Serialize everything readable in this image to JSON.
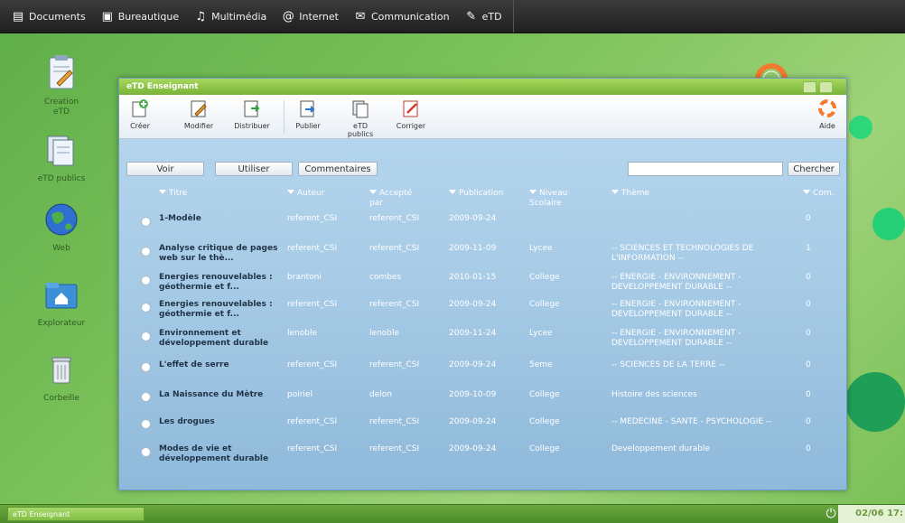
{
  "menubar": {
    "items": [
      {
        "label": "Documents",
        "icon": "documents-icon"
      },
      {
        "label": "Bureautique",
        "icon": "briefcase-icon"
      },
      {
        "label": "Multimédia",
        "icon": "music-note-icon"
      },
      {
        "label": "Internet",
        "icon": "at-sign-icon"
      },
      {
        "label": "Communication",
        "icon": "chat-bubbles-icon"
      },
      {
        "label": "eTD",
        "icon": "etd-icon"
      }
    ]
  },
  "desktop": {
    "icons": [
      {
        "label": "Creation\neTD",
        "icon": "create-etd-icon"
      },
      {
        "label": "eTD publics",
        "icon": "etd-publics-icon"
      },
      {
        "label": "Web",
        "icon": "globe-icon"
      },
      {
        "label": "Explorateur",
        "icon": "home-folder-icon"
      },
      {
        "label": "Corbeille",
        "icon": "trash-icon"
      }
    ]
  },
  "window": {
    "title": "eTD Enseignant",
    "toolbar": [
      {
        "label": "Créer",
        "icon": "create-icon"
      },
      {
        "label": "Modifier",
        "icon": "edit-icon"
      },
      {
        "label": "Distribuer",
        "icon": "distribute-icon"
      },
      {
        "label": "Publier",
        "icon": "publish-icon"
      },
      {
        "label": "eTD publics",
        "icon": "public-docs-icon"
      },
      {
        "label": "Corriger",
        "icon": "correct-icon"
      }
    ],
    "help_label": "Aide",
    "buttons": {
      "voir": "Voir",
      "utiliser": "Utiliser",
      "commentaires": "Commentaires",
      "chercher": "Chercher"
    },
    "search": {
      "value": ""
    },
    "columns": [
      "Titre",
      "Auteur",
      "Accepté par",
      "Publication",
      "Niveau Scolaire",
      "Thème",
      "Com."
    ],
    "rows": [
      {
        "titre": "1-Modèle",
        "auteur": "referent_CSI",
        "accepte": "referent_CSI",
        "publication": "2009-09-24",
        "niveau": "",
        "theme": "",
        "com": "0"
      },
      {
        "titre": "Analyse critique de pages web sur le thè...",
        "auteur": "referent_CSI",
        "accepte": "referent_CSI",
        "publication": "2009-11-09",
        "niveau": "Lycee",
        "theme": "-- SCIENCES ET TECHNOLOGIES DE L'INFORMATION --",
        "com": "1"
      },
      {
        "titre": "Energies renouvelables : géothermie et f...",
        "auteur": "brantoni",
        "accepte": "combes",
        "publication": "2010-01-15",
        "niveau": "College",
        "theme": "-- ENERGIE - ENVIRONNEMENT - DEVELOPPEMENT DURABLE --",
        "com": "0"
      },
      {
        "titre": "Energies renouvelables : géothermie et f...",
        "auteur": "referent_CSI",
        "accepte": "referent_CSI",
        "publication": "2009-09-24",
        "niveau": "College",
        "theme": "-- ENERGIE - ENVIRONNEMENT - DEVELOPPEMENT DURABLE --",
        "com": "0"
      },
      {
        "titre": "Environnement et développement durable",
        "auteur": "lenoble",
        "accepte": "lenoble",
        "publication": "2009-11-24",
        "niveau": "Lycee",
        "theme": "-- ENERGIE - ENVIRONNEMENT - DEVELOPPEMENT DURABLE --",
        "com": "0"
      },
      {
        "titre": "L'effet de serre",
        "auteur": "referent_CSI",
        "accepte": "referent_CSI",
        "publication": "2009-09-24",
        "niveau": "5eme",
        "theme": "-- SCIENCES DE LA TERRE --",
        "com": "0"
      },
      {
        "titre": "La Naissance du Mètre",
        "auteur": "poiriel",
        "accepte": "delon",
        "publication": "2009-10-09",
        "niveau": "College",
        "theme": "Histoire des sciences",
        "com": "0"
      },
      {
        "titre": "Les drogues",
        "auteur": "referent_CSI",
        "accepte": "referent_CSI",
        "publication": "2009-09-24",
        "niveau": "College",
        "theme": "-- MEDECINE - SANTE - PSYCHOLOGIE --",
        "com": "0"
      },
      {
        "titre": "Modes de vie et développement durable",
        "auteur": "referent_CSI",
        "accepte": "referent_CSI",
        "publication": "2009-09-24",
        "niveau": "College",
        "theme": "Developpement durable",
        "com": "0"
      }
    ]
  },
  "taskbar": {
    "task_label": "eTD Enseignant",
    "clock": "02/06  17:",
    "power_icon": "power-icon"
  },
  "colors": {
    "titlebar": "#8cc84b",
    "window_bg": "#a7cbe6",
    "desktop": "#7cc25a",
    "taskbar": "#5a9a33"
  }
}
